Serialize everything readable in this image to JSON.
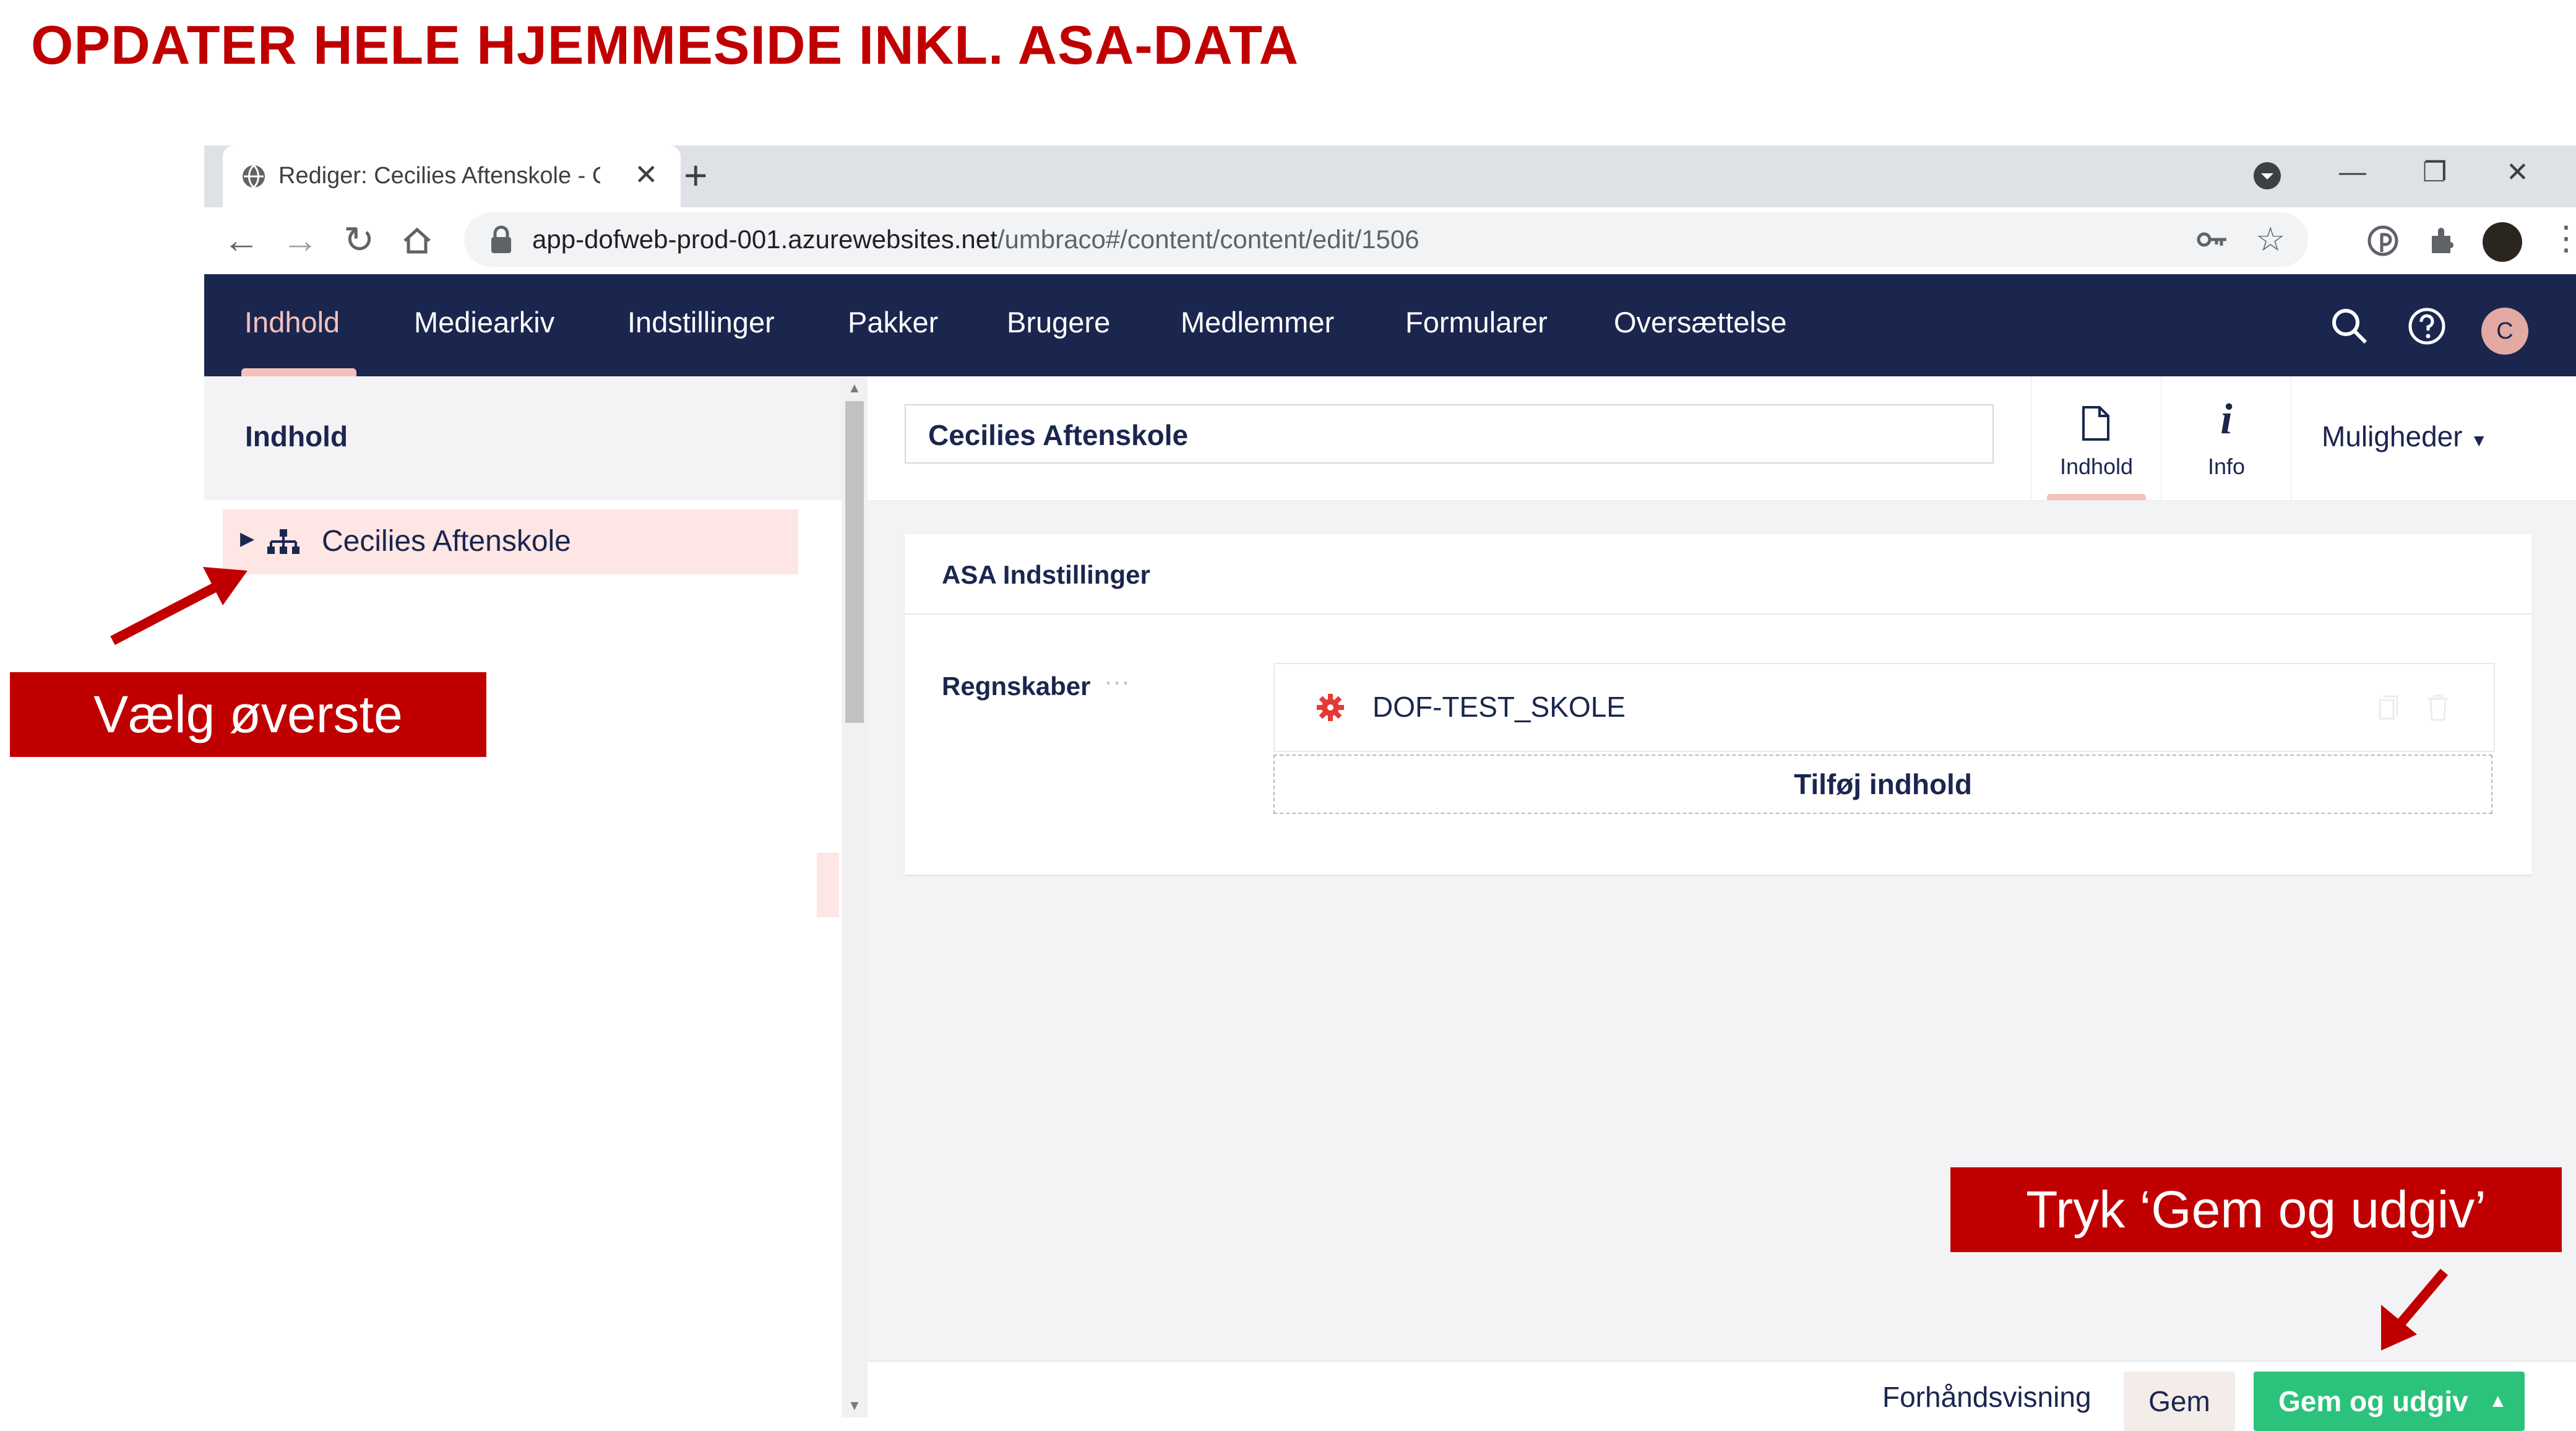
{
  "slide": {
    "title": "OPDATER HELE HJEMMESIDE INKL. ASA-DATA"
  },
  "browser": {
    "tab": {
      "title": "Rediger: Cecilies Aftenskole - Co"
    },
    "url": {
      "host": "app-dofweb-prod-001.azurewebsites.net",
      "path": "/umbraco#/content/content/edit/1506"
    }
  },
  "umbraco": {
    "nav": {
      "items": [
        {
          "label": "Indhold",
          "active": true
        },
        {
          "label": "Mediearkiv"
        },
        {
          "label": "Indstillinger"
        },
        {
          "label": "Pakker"
        },
        {
          "label": "Brugere"
        },
        {
          "label": "Medlemmer"
        },
        {
          "label": "Formularer"
        },
        {
          "label": "Oversættelse"
        }
      ],
      "avatar_initial": "C"
    },
    "tree": {
      "header": "Indhold",
      "items": [
        {
          "label": "Cecilies Aftenskole"
        }
      ]
    },
    "editor": {
      "name": "Cecilies Aftenskole",
      "apps": [
        {
          "label": "Indhold",
          "icon": "document-icon",
          "active": true
        },
        {
          "label": "Info",
          "icon": "info-icon"
        }
      ],
      "actions_label": "Muligheder",
      "group": {
        "title": "ASA Indstillinger",
        "property": {
          "label": "Regnskaber",
          "dots": "···",
          "block_label": "DOF-TEST_SKOLE",
          "add_label": "Tilføj indhold"
        }
      }
    },
    "footer": {
      "preview_label": "Forhåndsvisning",
      "save_label": "Gem",
      "publish_label": "Gem og udgiv"
    }
  },
  "annotations": {
    "callout_left": "Vælg øverste",
    "callout_right": "Tryk ‘Gem og udgiv’"
  },
  "colors": {
    "accent_red": "#c00000",
    "umbraco_navy": "#1b264f",
    "umbraco_pink": "#f5c1bc",
    "publish_green": "#2bc37c"
  }
}
